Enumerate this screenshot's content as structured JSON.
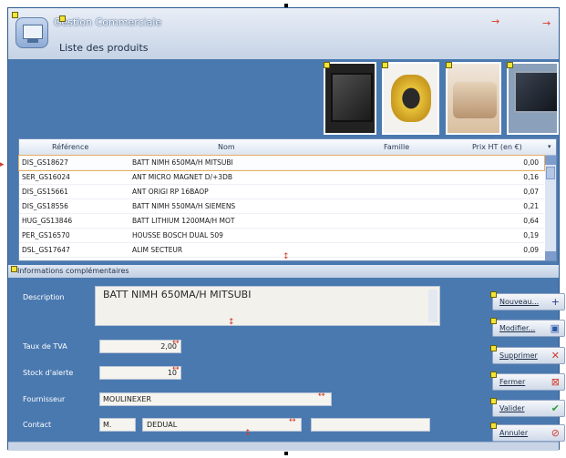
{
  "header": {
    "app_title": "Gestion Commerciale",
    "subtitle": "Liste des produits"
  },
  "table": {
    "columns": [
      "Référence",
      "Nom",
      "Famille",
      "Prix HT (en €)"
    ],
    "rows": [
      {
        "ref": "DIS_GS18627",
        "nom": "BATT NIMH 650MA/H MITSUBI",
        "famille": "",
        "prix": "0,00"
      },
      {
        "ref": "SER_GS16024",
        "nom": "ANT MICRO MAGNET D/+3DB",
        "famille": "",
        "prix": "0,16"
      },
      {
        "ref": "DIS_GS15661",
        "nom": "ANT ORIGI RP 16BAOP",
        "famille": "",
        "prix": "0,07"
      },
      {
        "ref": "DIS_GS18556",
        "nom": "BATT NIMH 550MA/H SIEMENS",
        "famille": "",
        "prix": "0,21"
      },
      {
        "ref": "HUG_GS13846",
        "nom": "BATT LITHIUM 1200MA/H MOT",
        "famille": "",
        "prix": "0,64"
      },
      {
        "ref": "PER_GS16570",
        "nom": "HOUSSE BOSCH DUAL 509",
        "famille": "",
        "prix": "0,19"
      },
      {
        "ref": "DSL_GS17647",
        "nom": "ALIM SECTEUR",
        "famille": "",
        "prix": "0,09"
      }
    ]
  },
  "info": {
    "section_title": "Informations complémentaires",
    "description_label": "Description",
    "description_value": "BATT NIMH 650MA/H MITSUBI",
    "taux_label": "Taux de TVA",
    "taux_value": "2,00",
    "stock_label": "Stock d'alerte",
    "stock_value": "10",
    "fournisseur_label": "Fournisseur",
    "fournisseur_value": "MOULINEXER",
    "contact_label": "Contact",
    "contact_value1": "M.",
    "contact_value2": "DEDUAL",
    "contact_value3": ""
  },
  "buttons": {
    "nouveau": "Nouveau...",
    "modifier": "Modifier...",
    "supprimer": "Supprimer",
    "fermer": "Fermer",
    "valider": "Valider",
    "annuler": "Annuler"
  },
  "icons": {
    "nouveau": "plus-icon",
    "modifier": "save-icon",
    "supprimer": "delete-x-icon",
    "fermer": "close-icon",
    "valider": "check-icon",
    "annuler": "cancel-icon"
  },
  "colors": {
    "frame": "#4a79b0",
    "header": "#c5d3e6",
    "selection": "#e8b060",
    "check": "#2e9d3a",
    "delete": "#d23a2a"
  }
}
